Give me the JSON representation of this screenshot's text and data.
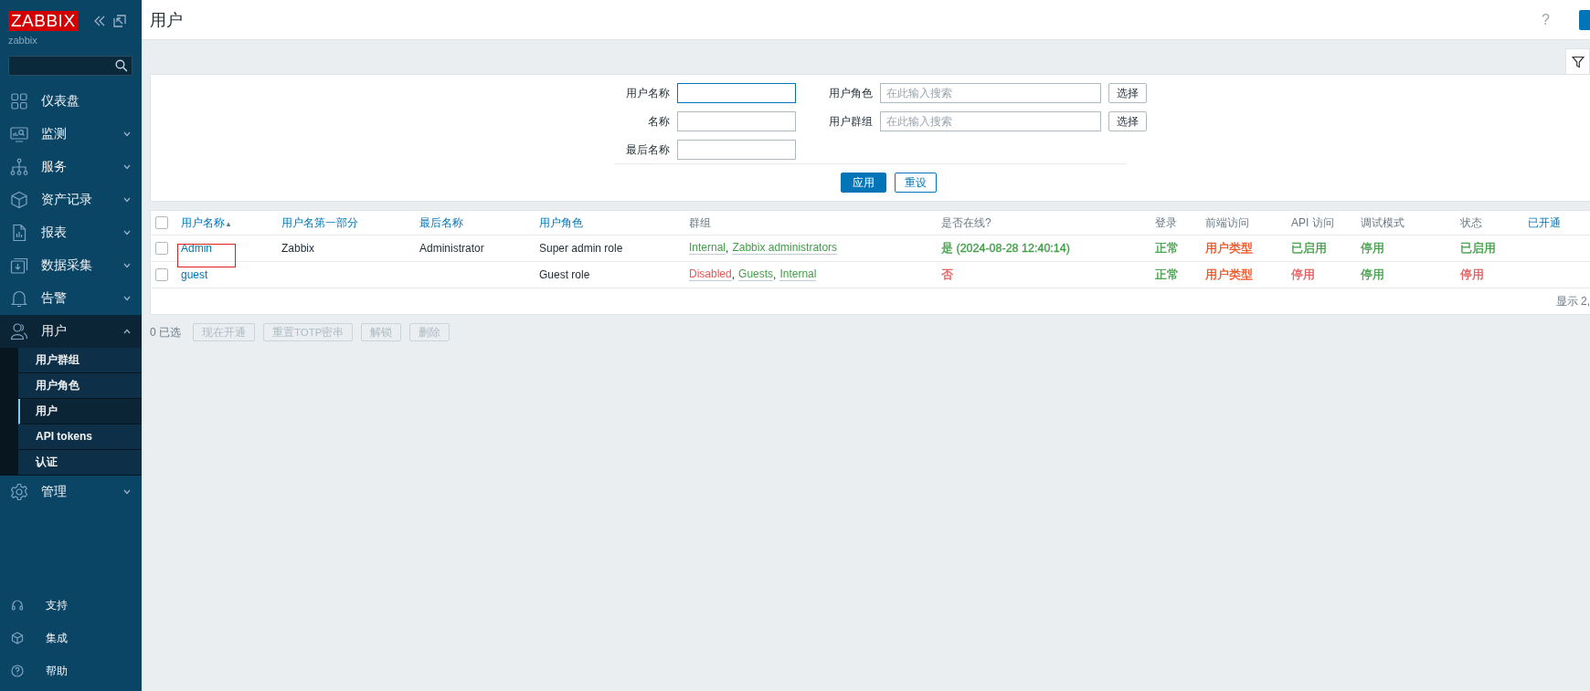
{
  "logo": {
    "text": "ZABBIX",
    "subtitle": "zabbix"
  },
  "sidebar": {
    "menu": [
      {
        "label": "仪表盘",
        "kind": "dashboard",
        "expandable": false,
        "expanded": false
      },
      {
        "label": "监测",
        "kind": "monitor",
        "expandable": true,
        "expanded": false
      },
      {
        "label": "服务",
        "kind": "hierarchy",
        "expandable": true,
        "expanded": false
      },
      {
        "label": "资产记录",
        "kind": "box",
        "expandable": true,
        "expanded": false
      },
      {
        "label": "报表",
        "kind": "report",
        "expandable": true,
        "expanded": false
      },
      {
        "label": "数据采集",
        "kind": "download",
        "expandable": true,
        "expanded": false
      },
      {
        "label": "告警",
        "kind": "bell",
        "expandable": true,
        "expanded": false
      },
      {
        "label": "用户",
        "kind": "users",
        "expandable": true,
        "expanded": true,
        "children": [
          {
            "label": "用户群组",
            "selected": false
          },
          {
            "label": "用户角色",
            "selected": false
          },
          {
            "label": "用户",
            "selected": true
          },
          {
            "label": "API tokens",
            "selected": false
          },
          {
            "label": "认证",
            "selected": false
          }
        ]
      },
      {
        "label": "管理",
        "kind": "gear",
        "expandable": true,
        "expanded": false
      }
    ],
    "footer": [
      {
        "label": "支持",
        "kind": "headset"
      },
      {
        "label": "集成",
        "kind": "cube"
      },
      {
        "label": "帮助",
        "kind": "help"
      }
    ]
  },
  "header": {
    "title": "用户",
    "help": "?"
  },
  "filter": {
    "left": [
      {
        "label": "用户名称",
        "focused": true
      },
      {
        "label": "名称",
        "focused": false
      },
      {
        "label": "最后名称",
        "focused": false
      }
    ],
    "right": [
      {
        "label": "用户角色",
        "placeholder": "在此输入搜索",
        "button": "选择"
      },
      {
        "label": "用户群组",
        "placeholder": "在此输入搜索",
        "button": "选择"
      }
    ],
    "apply": "应用",
    "reset": "重设"
  },
  "table": {
    "all_checked": false,
    "separator": ",",
    "columns": [
      {
        "label": "用户名称",
        "sortable": true,
        "sort_indicator": "▲"
      },
      {
        "label": "用户名第一部分",
        "sortable": true
      },
      {
        "label": "最后名称",
        "sortable": true
      },
      {
        "label": "用户角色",
        "sortable": true
      },
      {
        "label": "群组",
        "sortable": false
      },
      {
        "label": "是否在线?",
        "sortable": false
      },
      {
        "label": "登录",
        "sortable": false
      },
      {
        "label": "前端访问",
        "sortable": false
      },
      {
        "label": "API 访问",
        "sortable": false
      },
      {
        "label": "调试模式",
        "sortable": false
      },
      {
        "label": "状态",
        "sortable": false
      },
      {
        "label": "已开通",
        "sortable": true
      }
    ],
    "rows": [
      {
        "checked": false,
        "username": "Admin",
        "annotated": true,
        "first_name": "Zabbix",
        "last_name": "Administrator",
        "role": "Super admin role",
        "groups": [
          {
            "label": "Internal",
            "color": "#429e47"
          },
          {
            "label": "Zabbix administrators",
            "color": "#429e47"
          }
        ],
        "online": {
          "text": "是 (2024-08-28 12:40:14)",
          "color": "#429e47"
        },
        "login": {
          "text": "正常",
          "color": "#429e47"
        },
        "frontend": {
          "text": "用户类型",
          "color": "#f24f1d"
        },
        "api": {
          "text": "已启用",
          "color": "#429e47"
        },
        "debug": {
          "text": "停用",
          "color": "#429e47"
        },
        "status": {
          "text": "已启用",
          "color": "#429e47"
        }
      },
      {
        "checked": false,
        "username": "guest",
        "annotated": false,
        "first_name": "",
        "last_name": "",
        "role": "Guest role",
        "groups": [
          {
            "label": "Disabled",
            "color": "#e45959"
          },
          {
            "label": "Guests",
            "color": "#429e47"
          },
          {
            "label": "Internal",
            "color": "#429e47"
          }
        ],
        "online": {
          "text": "否",
          "color": "#e45959"
        },
        "login": {
          "text": "正常",
          "color": "#429e47"
        },
        "frontend": {
          "text": "用户类型",
          "color": "#f24f1d"
        },
        "api": {
          "text": "停用",
          "color": "#e45959"
        },
        "debug": {
          "text": "停用",
          "color": "#429e47"
        },
        "status": {
          "text": "停用",
          "color": "#e45959"
        }
      }
    ],
    "footer": "显示 2,"
  },
  "actions": {
    "selected_count": "0 已选",
    "buttons": [
      {
        "label": "现在开通",
        "disabled": true
      },
      {
        "label": "重置TOTP密串",
        "disabled": true
      },
      {
        "label": "解锁",
        "disabled": true
      },
      {
        "label": "删除",
        "disabled": true
      }
    ]
  }
}
